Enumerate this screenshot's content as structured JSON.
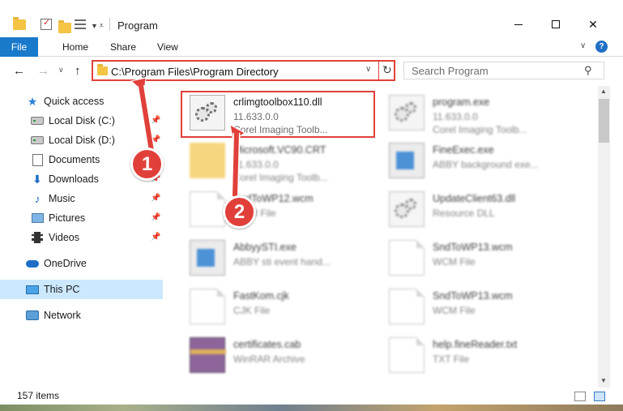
{
  "window": {
    "title": "Program",
    "controls": {
      "minimize": "minimize",
      "maximize": "maximize",
      "close": "close"
    }
  },
  "ribbon": {
    "tabs": [
      {
        "label": "File",
        "active": true
      },
      {
        "label": "Home"
      },
      {
        "label": "Share"
      },
      {
        "label": "View"
      }
    ],
    "help": "?"
  },
  "navigation": {
    "address": "C:\\Program Files\\Program Directory",
    "search_placeholder": "Search Program"
  },
  "sidebar": {
    "items": [
      {
        "label": "Quick access",
        "icon": "star-icon",
        "pinned": false
      },
      {
        "label": "Local Disk (C:)",
        "icon": "disk-icon",
        "pinned": true
      },
      {
        "label": "Local Disk (D:)",
        "icon": "disk-icon",
        "pinned": true
      },
      {
        "label": "Documents",
        "icon": "documents-icon",
        "pinned": true
      },
      {
        "label": "Downloads",
        "icon": "downloads-icon",
        "pinned": true
      },
      {
        "label": "Music",
        "icon": "music-icon",
        "pinned": true
      },
      {
        "label": "Pictures",
        "icon": "pictures-icon",
        "pinned": true
      },
      {
        "label": "Videos",
        "icon": "videos-icon",
        "pinned": true
      },
      {
        "label": "OneDrive",
        "icon": "onedrive-icon",
        "pinned": false
      },
      {
        "label": "This PC",
        "icon": "this-pc-icon",
        "pinned": false,
        "selected": true
      },
      {
        "label": "Network",
        "icon": "network-icon",
        "pinned": false
      }
    ]
  },
  "files": {
    "left": [
      {
        "name": "crlimgtoolbox110.dll",
        "line2": "11.633.0.0",
        "line3": "Corel Imaging Toolb...",
        "icon": "dll-gear-icon",
        "highlighted": true
      },
      {
        "name": "Microsoft.VC90.CRT",
        "line2": "11.633.0.0",
        "line3": "Corel Imaging Toolb...",
        "icon": "folder-icon"
      },
      {
        "name": "SndToWP12.wcm",
        "line2": "WCM File",
        "line3": "",
        "icon": "document-icon"
      },
      {
        "name": "AbbyySTI.exe",
        "line2": "ABBY sti event hand...",
        "line3": "",
        "icon": "exe-icon"
      },
      {
        "name": "FastKom.cjk",
        "line2": "CJK File",
        "line3": "",
        "icon": "document-icon"
      },
      {
        "name": "certificates.cab",
        "line2": "WinRAR Archive",
        "line3": "",
        "icon": "archive-icon"
      }
    ],
    "right": [
      {
        "name": "program.exe",
        "line2": "11.633.0.0",
        "line3": "Corel Imaging Toolb...",
        "icon": "dll-gear-icon"
      },
      {
        "name": "FineExec.exe",
        "line2": "ABBY background exe...",
        "line3": "",
        "icon": "exe-icon"
      },
      {
        "name": "UpdateClient63.dll",
        "line2": "Resource DLL",
        "line3": "",
        "icon": "dll-gear-icon"
      },
      {
        "name": "SndToWP13.wcm",
        "line2": "WCM File",
        "line3": "",
        "icon": "document-icon"
      },
      {
        "name": "SndToWP13.wcm",
        "line2": "WCM File",
        "line3": "",
        "icon": "document-icon"
      },
      {
        "name": "help.fineReader.txt",
        "line2": "TXT File",
        "line3": "",
        "icon": "document-icon"
      }
    ]
  },
  "annotations": {
    "step1": "1",
    "step2": "2",
    "accent": "#e1403a"
  },
  "status": {
    "item_count": "157 items"
  }
}
